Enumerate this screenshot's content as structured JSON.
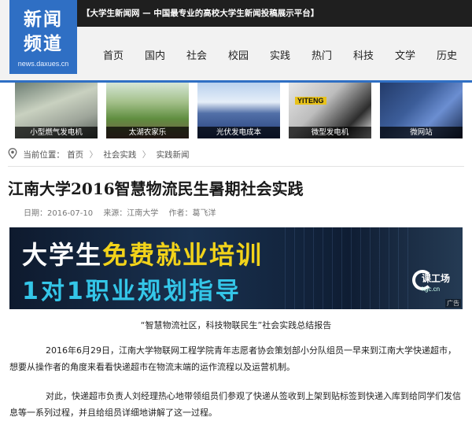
{
  "logo": {
    "line1": "新闻",
    "line2": "频道",
    "url": "news.daxues.cn"
  },
  "topbar": {
    "text": "【大学生新闻网 — 中国最专业的高校大学生新闻投稿展示平台】"
  },
  "nav": [
    "首页",
    "国内",
    "社会",
    "校园",
    "实践",
    "热门",
    "科技",
    "文学",
    "历史"
  ],
  "thumbnails": [
    {
      "caption": "小型燃气发电机"
    },
    {
      "caption": "太湖农家乐"
    },
    {
      "caption": "光伏发电成本"
    },
    {
      "caption": "微型发电机"
    },
    {
      "caption": "微网站"
    }
  ],
  "thumb_text": {
    "brand": "YITENG"
  },
  "breadcrumb": {
    "label": "当前位置：",
    "items": [
      "首页",
      "社会实践",
      "实践新闻"
    ],
    "separator": "〉"
  },
  "article": {
    "title": "江南大学2016智慧物流民生暑期社会实践",
    "date": "日期：2016-07-10",
    "source": "来源：江南大学",
    "author": "作者：葛飞洋"
  },
  "banner": {
    "line1_white": "大学生",
    "line1_yellow": "免费就业培训",
    "line2": "1对1职业规划指导",
    "logo_name": "课工场",
    "logo_domain": "kgc.cn",
    "ad_tag": "广告"
  },
  "content": {
    "subtitle": "“智慧物流社区，科技物联民生”社会实践总结报告",
    "p1": "2016年6月29日，江南大学物联网工程学院青年志愿者协会策划部小分队组员一早来到江南大学快递超市，想要从操作者的角度来看看快递超市在物流末端的运作流程以及运营机制。",
    "p2": "对此，快递超市负责人刘经理热心地带领组员们参观了快递从签收到上架到贴标签到快递入库到给同学们发信息等一系列过程，并且给组员详细地讲解了这一过程。"
  },
  "colors": {
    "brand_blue": "#2f6fc4",
    "banner_yellow": "#f2d31a",
    "banner_cyan": "#34c6e8"
  }
}
